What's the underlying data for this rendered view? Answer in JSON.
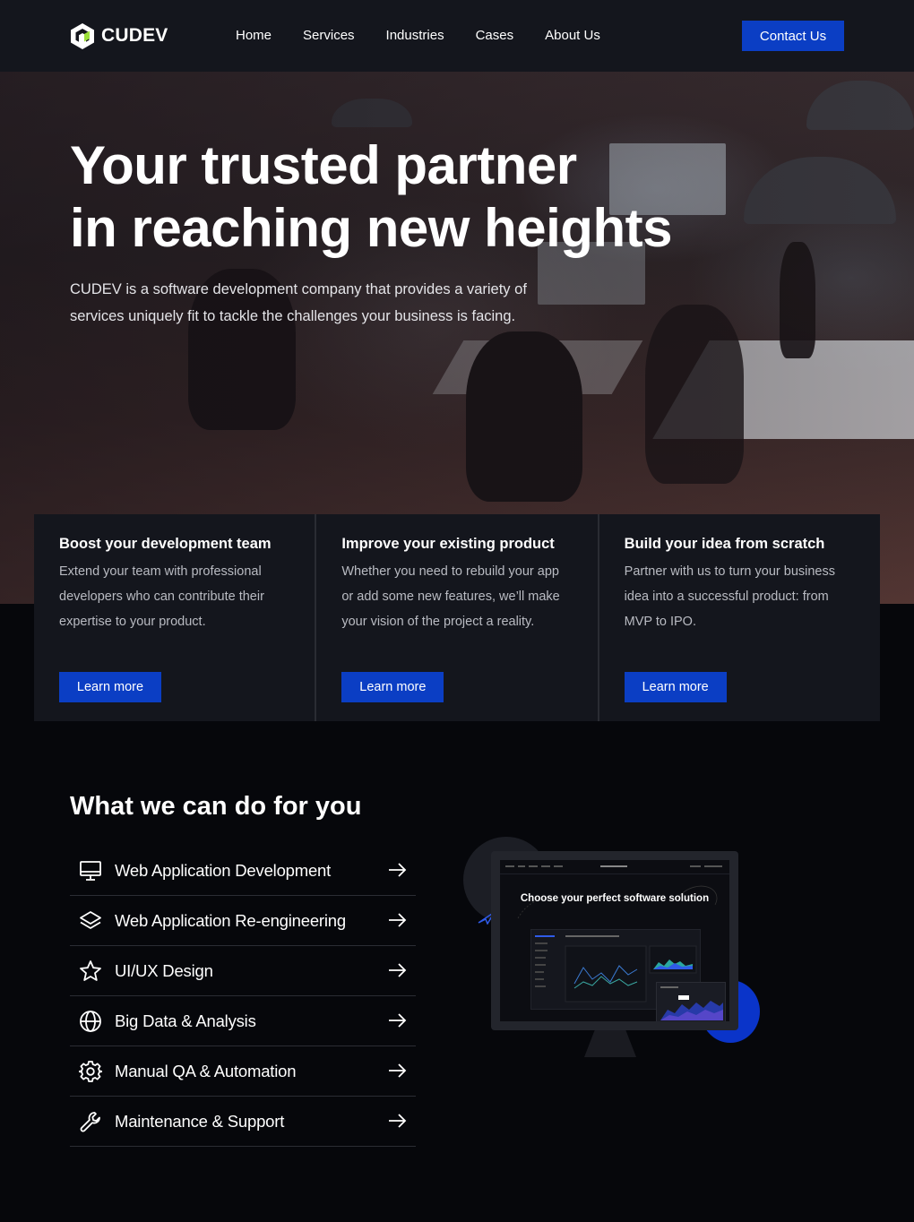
{
  "brand": {
    "name": "CUDEV"
  },
  "nav": {
    "links": [
      "Home",
      "Services",
      "Industries",
      "Cases",
      "About Us"
    ],
    "contact_label": "Contact Us"
  },
  "hero": {
    "title_line1": "Your trusted partner",
    "title_line2": "in reaching new heights",
    "subtitle": "CUDEV is a software development company that provides a variety of services uniquely fit to tackle the challenges your business is facing."
  },
  "cards": [
    {
      "title": "Boost your development team",
      "text": "Extend your team with professional developers who can contribute their expertise to your product.",
      "button": "Learn more"
    },
    {
      "title": "Improve your existing product",
      "text": "Whether you need to rebuild your app or add some new features, we’ll make your vision of the project a reality.",
      "button": "Learn more"
    },
    {
      "title": "Build your idea from scratch",
      "text": "Partner with us to turn your business idea into a successful product: from MVP to IPO.",
      "button": "Learn more"
    }
  ],
  "services": {
    "title": "What we can do for you",
    "items": [
      {
        "label": "Web Application Development",
        "icon": "monitor-icon"
      },
      {
        "label": "Web Application Re-engineering",
        "icon": "layers-icon"
      },
      {
        "label": "UI/UX Design",
        "icon": "star-icon"
      },
      {
        "label": "Big Data & Analysis",
        "icon": "globe-icon"
      },
      {
        "label": "Manual QA & Automation",
        "icon": "gear-icon"
      },
      {
        "label": "Maintenance & Support",
        "icon": "wrench-icon"
      }
    ]
  },
  "mockup": {
    "screen_title": "Choose your perfect software solution"
  },
  "colors": {
    "accent": "#0b3ec4",
    "nav_bg": "#14161d",
    "page_bg": "#06070b",
    "card_bg": "#14161d"
  }
}
